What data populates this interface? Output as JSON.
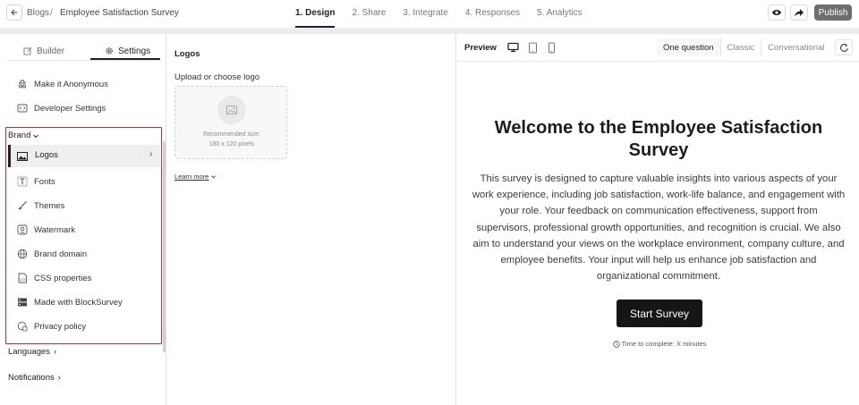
{
  "header": {
    "breadcrumb": {
      "root": "Blogs",
      "separator": "/",
      "current": "Employee Satisfaction Survey"
    },
    "steps": [
      {
        "label": "1. Design",
        "active": true
      },
      {
        "label": "2. Share",
        "active": false
      },
      {
        "label": "3. Integrate",
        "active": false
      },
      {
        "label": "4. Responses",
        "active": false
      },
      {
        "label": "5. Analytics",
        "active": false
      }
    ],
    "actions": {
      "preview_icon": "eye-icon",
      "share_icon": "share-arrow-icon",
      "publish_label": "Publish"
    }
  },
  "sidebar": {
    "tabs": {
      "builder": "Builder",
      "settings": "Settings",
      "active": "Settings"
    },
    "settings_items": [
      {
        "label": "Make it Anonymous",
        "icon": "anonymous-icon"
      },
      {
        "label": "Developer Settings",
        "icon": "code-icon"
      }
    ],
    "brand_section": {
      "label": "Brand",
      "items": [
        {
          "label": "Logos",
          "icon": "image-icon",
          "active": true
        },
        {
          "label": "Fonts",
          "icon": "font-icon"
        },
        {
          "label": "Themes",
          "icon": "brush-icon"
        },
        {
          "label": "Watermark",
          "icon": "watermark-icon"
        },
        {
          "label": "Brand domain",
          "icon": "globe-icon"
        },
        {
          "label": "CSS properties",
          "icon": "css-icon"
        },
        {
          "label": "Made with BlockSurvey",
          "icon": "blocksurvey-icon"
        },
        {
          "label": "Privacy policy",
          "icon": "privacy-icon"
        }
      ]
    },
    "sections": {
      "languages": "Languages",
      "notifications": "Notifications"
    }
  },
  "logos_panel": {
    "title": "Logos",
    "upload_label": "Upload or choose logo",
    "recommended_label": "Recommended size:",
    "recommended_size": "180 x 120 pixels",
    "learn_more": "Learn more"
  },
  "preview": {
    "label": "Preview",
    "modes": [
      "One question",
      "Classic",
      "Conversational"
    ],
    "active_mode": "One question",
    "title": "Welcome to the Employee Satisfaction Survey",
    "description": "This survey is designed to capture valuable insights into various aspects of your work experience, including job satisfaction, work-life balance, and engagement with your role. Your feedback on communication effectiveness, support from supervisors, professional growth opportunities, and recognition is crucial. We also aim to understand your views on the workplace environment, company culture, and employee benefits. Your input will help us enhance job satisfaction and organizational commitment.",
    "start_button": "Start Survey",
    "time_to_complete": "Time to complete: X minutes"
  },
  "colors": {
    "highlight_border": "#d9252a",
    "primary_button": "#161616",
    "publish_button": "#6e6e6e"
  }
}
